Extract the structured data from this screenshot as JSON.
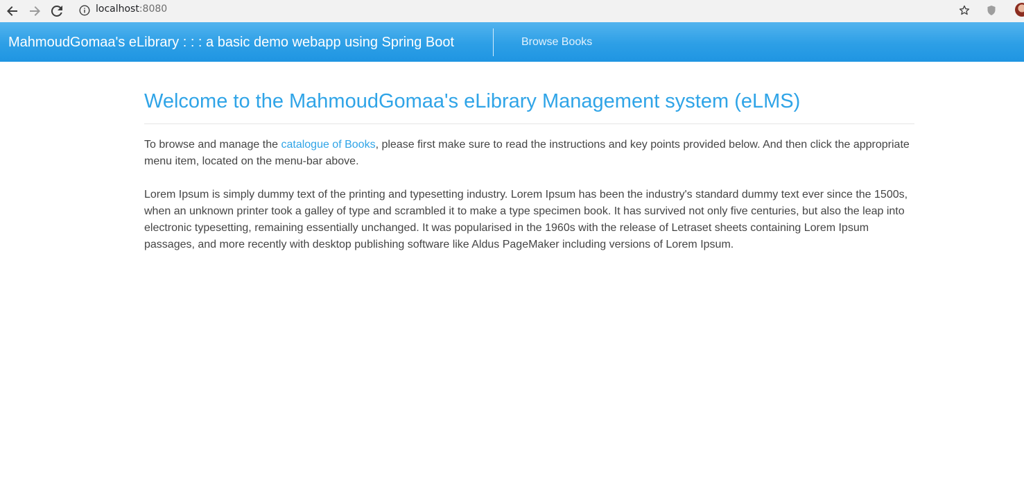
{
  "browser": {
    "url_host": "localhost",
    "url_port": ":8080",
    "icons": [
      "back-arrow-icon",
      "forward-arrow-icon",
      "reload-icon",
      "info-icon",
      "star-icon",
      "shield-icon"
    ]
  },
  "navbar": {
    "brand": "MahmoudGomaa's eLibrary : : : a basic demo webapp using Spring Boot",
    "browse_books": "Browse Books"
  },
  "main": {
    "title": "Welcome to the MahmoudGomaa's eLibrary Management system (eLMS)",
    "intro_before": "To browse and manage the ",
    "intro_link": "catalogue of Books",
    "intro_after": ", please first make sure to read the instructions and key points provided below. And then click the appropriate menu item, located on the menu-bar above.",
    "lorem": "Lorem Ipsum is simply dummy text of the printing and typesetting industry. Lorem Ipsum has been the industry's standard dummy text ever since the 1500s, when an unknown printer took a galley of type and scrambled it to make a type specimen book. It has survived not only five centuries, but also the leap into electronic typesetting, remaining essentially unchanged. It was popularised in the 1960s with the release of Letraset sheets containing Lorem Ipsum passages, and more recently with desktop publishing software like Aldus PageMaker including versions of Lorem Ipsum."
  },
  "colors": {
    "navbar": "#2d9fe6",
    "accent": "#2fa4e7",
    "text": "#444444"
  }
}
